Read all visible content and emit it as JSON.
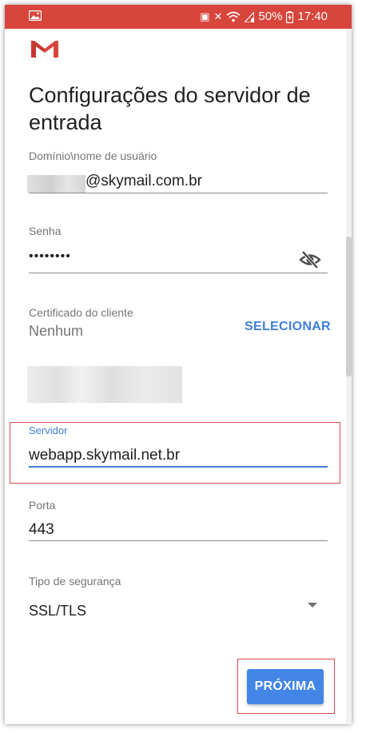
{
  "status_bar": {
    "battery_percent": "50%",
    "time": "17:40",
    "bg_color": "#d8453b"
  },
  "title": "Configurações do servidor de entrada",
  "username": {
    "label": "Domínio\\nome de usuário",
    "value": "@skymail.com.br"
  },
  "password": {
    "label": "Senha",
    "value": "••••••••"
  },
  "certificate": {
    "label": "Certificado do cliente",
    "value": "Nenhum",
    "action": "SELECIONAR"
  },
  "server": {
    "label": "Servidor",
    "value": "webapp.skymail.net.br",
    "accent_color": "#3f7fd7"
  },
  "port": {
    "label": "Porta",
    "value": "443"
  },
  "security": {
    "label": "Tipo de segurança",
    "value": "SSL/TLS"
  },
  "next_button": {
    "label": "PRÓXIMA",
    "color": "#4386e8"
  }
}
